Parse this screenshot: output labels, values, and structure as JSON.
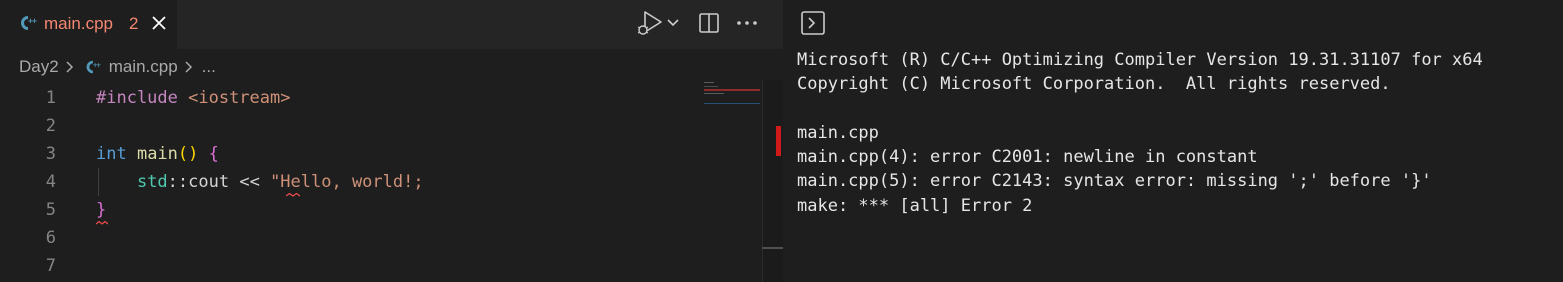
{
  "editor": {
    "tab": {
      "title": "main.cpp",
      "problems": "2"
    },
    "breadcrumb": {
      "folder": "Day2",
      "file": "main.cpp",
      "more": "..."
    },
    "lines": [
      {
        "num": "1",
        "tokens": [
          {
            "t": "#include ",
            "c": "t-pp"
          },
          {
            "t": "<iostream>",
            "c": "t-inc"
          }
        ]
      },
      {
        "num": "2",
        "tokens": []
      },
      {
        "num": "3",
        "tokens": [
          {
            "t": "int ",
            "c": "t-kw"
          },
          {
            "t": "main",
            "c": "t-fn"
          },
          {
            "t": "() ",
            "c": "t-br"
          },
          {
            "t": "{",
            "c": "t-br2"
          }
        ]
      },
      {
        "num": "4",
        "tokens": [
          {
            "t": "    ",
            "c": "t-op"
          },
          {
            "t": "std",
            "c": "t-ns"
          },
          {
            "t": "::",
            "c": "t-op"
          },
          {
            "t": "cout",
            "c": "t-op"
          },
          {
            "t": " << ",
            "c": "t-op"
          },
          {
            "t": "\"Hello, world!;",
            "c": "t-str"
          }
        ]
      },
      {
        "num": "5",
        "tokens": [
          {
            "t": "}",
            "c": "t-br2"
          }
        ]
      },
      {
        "num": "6",
        "tokens": []
      },
      {
        "num": "7",
        "tokens": []
      }
    ],
    "colors": {
      "error": "#f14c4c",
      "tab_error_text": "#f48771"
    }
  },
  "terminal": {
    "lines": [
      "Microsoft (R) C/C++ Optimizing Compiler Version 19.31.31107 for x64",
      "Copyright (C) Microsoft Corporation.  All rights reserved.",
      "",
      "main.cpp",
      "main.cpp(4): error C2001: newline in constant",
      "main.cpp(5): error C2143: syntax error: missing ';' before '}'",
      "make: *** [all] Error 2"
    ]
  },
  "icons": {
    "tab_file": "cpp-file-icon",
    "close": "close-icon",
    "run": "run-debug-icon",
    "run_dropdown": "chevron-down-icon",
    "split": "split-editor-icon",
    "more": "more-actions-icon",
    "terminal": "terminal-icon"
  }
}
